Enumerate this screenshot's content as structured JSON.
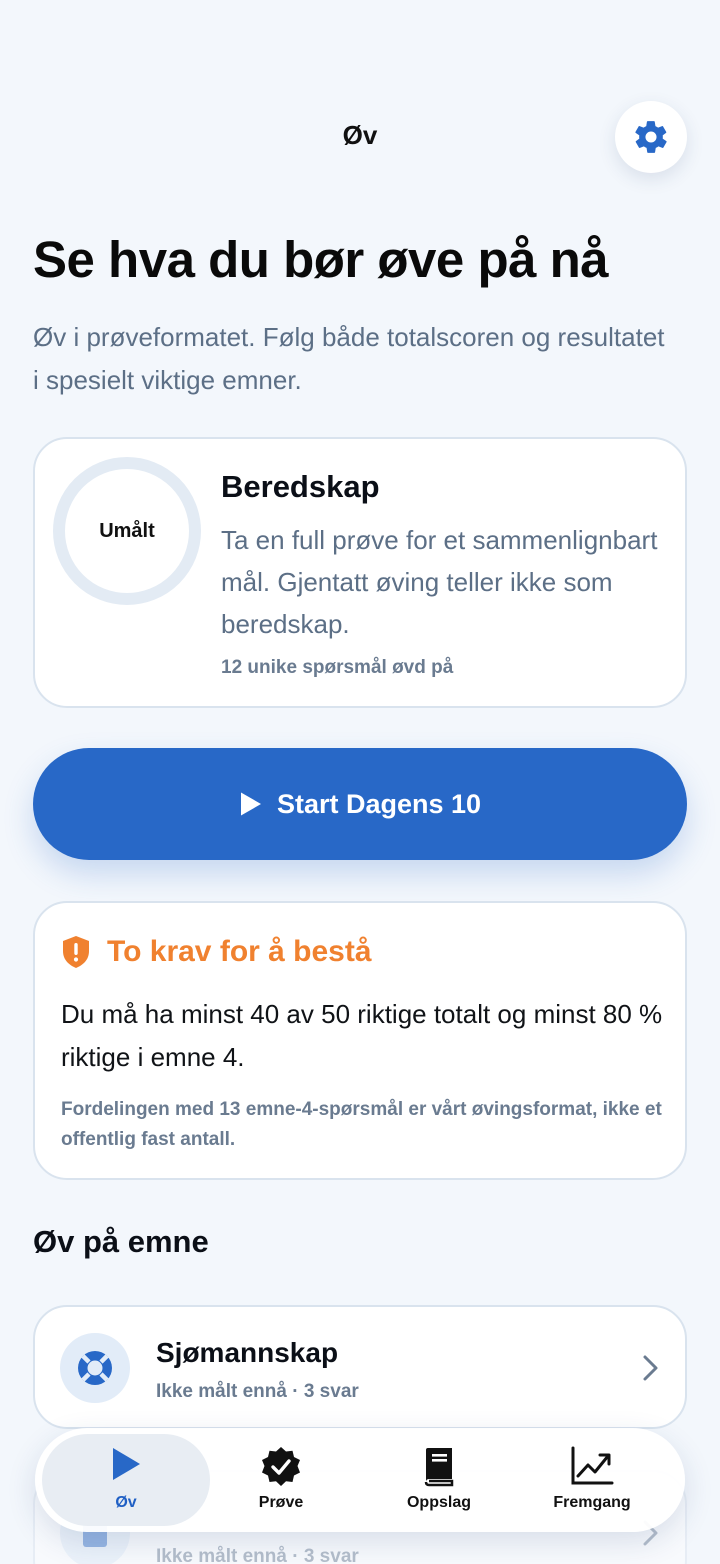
{
  "header": {
    "title": "Øv",
    "settings_icon": "gear-icon"
  },
  "hero": {
    "headline": "Se hva du bør øve på nå",
    "subhead": "Øv i prøveformatet. Følg både totalscoren og resultatet i spesielt viktige emner."
  },
  "readiness": {
    "ring_label": "Umålt",
    "title": "Beredskap",
    "body": "Ta en full prøve for et sammenlignbart mål. Gjentatt øving teller ikke som beredskap.",
    "meta": "12 unike spørsmål øvd på"
  },
  "start_button": {
    "label": "Start Dagens 10",
    "icon": "play-icon"
  },
  "requirements": {
    "title": "To krav for å bestå",
    "icon": "shield-alert-icon",
    "body": "Du må ha minst 40 av 50 riktige totalt og minst 80 % riktige i emne 4.",
    "note": "Fordelingen med 13 emne-4-spørsmål er vårt øvingsformat, ikke et offentlig fast antall."
  },
  "topics_section": {
    "title": "Øv på emne",
    "items": [
      {
        "title": "Sjømannskap",
        "meta": "Ikke målt ennå · 3 svar",
        "icon": "lifebuoy-icon"
      },
      {
        "title": "",
        "meta": "Ikke målt ennå · 3 svar",
        "icon": "book-icon"
      }
    ]
  },
  "tabbar": {
    "tabs": [
      {
        "label": "Øv",
        "icon": "play-icon",
        "active": true
      },
      {
        "label": "Prøve",
        "icon": "badge-check-icon",
        "active": false
      },
      {
        "label": "Oppslag",
        "icon": "book-icon",
        "active": false
      },
      {
        "label": "Fremgang",
        "icon": "chart-line-icon",
        "active": false
      }
    ]
  },
  "colors": {
    "accent": "#2868c7",
    "warning": "#f0812f",
    "muted_text": "#5c6f86",
    "background": "#f3f7fc"
  }
}
